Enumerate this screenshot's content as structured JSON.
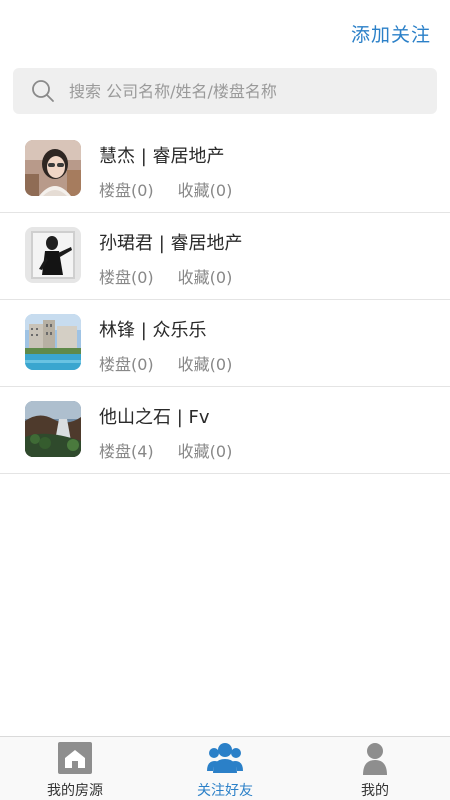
{
  "header": {
    "add_follow_label": "添加关注"
  },
  "search": {
    "placeholder": "搜索 公司名称/姓名/楼盘名称",
    "value": ""
  },
  "contacts": [
    {
      "name": "慧杰 | 睿居地产",
      "listings": "楼盘(0)",
      "favorites": "收藏(0)"
    },
    {
      "name": "孙珺君 | 睿居地产",
      "listings": "楼盘(0)",
      "favorites": "收藏(0)"
    },
    {
      "name": "林锋 | 众乐乐",
      "listings": "楼盘(0)",
      "favorites": "收藏(0)"
    },
    {
      "name": "他山之石 | Fv",
      "listings": "楼盘(4)",
      "favorites": "收藏(0)"
    }
  ],
  "tabbar": {
    "tabs": [
      {
        "label": "我的房源",
        "icon": "house-icon",
        "active": false
      },
      {
        "label": "关注好友",
        "icon": "friends-icon",
        "active": true
      },
      {
        "label": "我的",
        "icon": "person-icon",
        "active": false
      }
    ]
  },
  "colors": {
    "accent": "#2b80c8",
    "inactive_icon": "#8e8e8e",
    "stat_text": "#888888"
  }
}
